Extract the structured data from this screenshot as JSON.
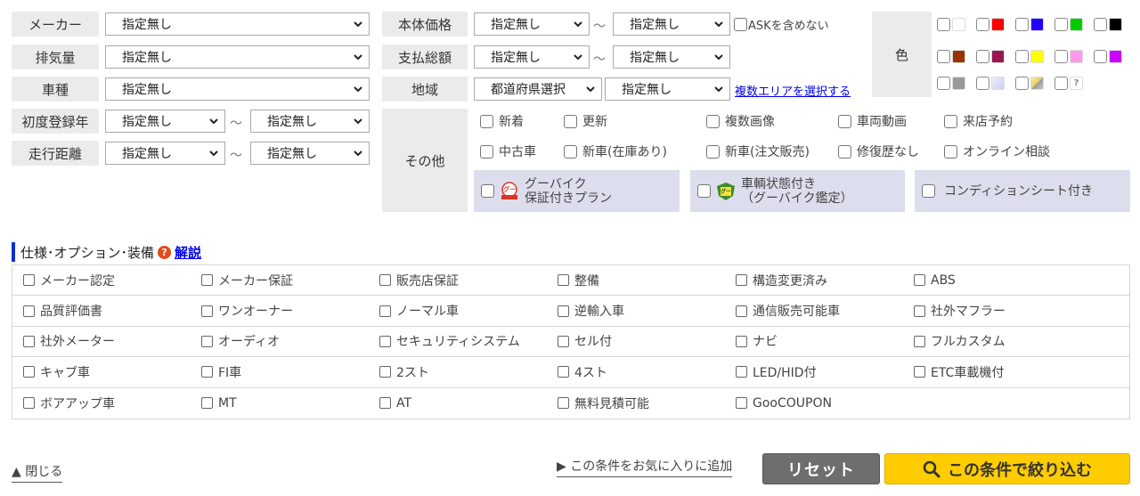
{
  "filters": {
    "maker": {
      "label": "メーカー",
      "value": "指定無し"
    },
    "displacement": {
      "label": "排気量",
      "value": "指定無し"
    },
    "model": {
      "label": "車種",
      "value": "指定無し"
    },
    "first_reg_year": {
      "label": "初度登録年",
      "from": "指定無し",
      "to": "指定無し"
    },
    "mileage": {
      "label": "走行距離",
      "from": "指定無し",
      "to": "指定無し"
    },
    "body_price": {
      "label": "本体価格",
      "from": "指定無し",
      "to": "指定無し",
      "ask_exclude_label": "ASKを含めない"
    },
    "total_payment": {
      "label": "支払総額",
      "from": "指定無し",
      "to": "指定無し"
    },
    "region": {
      "label": "地域",
      "prefecture": "都道府県選択",
      "area": "指定無し",
      "multi_area_link": "複数エリアを選択する"
    },
    "tilde": "～"
  },
  "color": {
    "label": "色",
    "swatches": [
      {
        "name": "white",
        "color": "#ffffff"
      },
      {
        "name": "red",
        "color": "#ff0000"
      },
      {
        "name": "blue",
        "color": "#2200ff"
      },
      {
        "name": "green",
        "color": "#00cc00"
      },
      {
        "name": "black",
        "color": "#000000"
      },
      {
        "name": "brown",
        "color": "#993300"
      },
      {
        "name": "wine",
        "color": "#991551"
      },
      {
        "name": "yellow",
        "color": "#ffff00"
      },
      {
        "name": "pink",
        "color": "#ff99ee"
      },
      {
        "name": "purple",
        "color": "#cc00ff"
      },
      {
        "name": "gray",
        "color": "#999999"
      },
      {
        "name": "silver",
        "color": "#dcdcf5"
      },
      {
        "name": "gold",
        "color": "#e6d36a"
      },
      {
        "name": "unknown",
        "color": "#ffffff",
        "glyph": "?"
      }
    ]
  },
  "other": {
    "label": "その他",
    "row1": [
      "新着",
      "更新",
      "複数画像",
      "車両動画",
      "来店予約"
    ],
    "row2": [
      "中古車",
      "新車(在庫あり)",
      "新車(注文販売)",
      "修復歴なし",
      "オンライン相談"
    ],
    "banners": [
      {
        "line1": "グーバイク",
        "line2": "保証付きプラン"
      },
      {
        "line1": "車輌状態付き",
        "line2": "（グーバイク鑑定）"
      },
      {
        "line1": "コンディションシート付き"
      }
    ]
  },
  "spec": {
    "title": "仕様･オプション･装備",
    "help_link": "解説",
    "rows": [
      [
        "メーカー認定",
        "メーカー保証",
        "販売店保証",
        "整備",
        "構造変更済み",
        "ABS"
      ],
      [
        "品質評価書",
        "ワンオーナー",
        "ノーマル車",
        "逆輸入車",
        "通信販売可能車",
        "社外マフラー"
      ],
      [
        "社外メーター",
        "オーディオ",
        "セキュリティシステム",
        "セル付",
        "ナビ",
        "フルカスタム"
      ],
      [
        "キャブ車",
        "FI車",
        "2スト",
        "4スト",
        "LED/HID付",
        "ETC車載機付"
      ],
      [
        "ボアアップ車",
        "MT",
        "AT",
        "無料見積可能",
        "GooCOUPON"
      ]
    ]
  },
  "footer": {
    "close_label": "▲ 閉じる",
    "favorite_label": "▶ この条件をお気に入りに追加",
    "reset_label": "リセット",
    "search_label": "この条件で絞り込む"
  }
}
